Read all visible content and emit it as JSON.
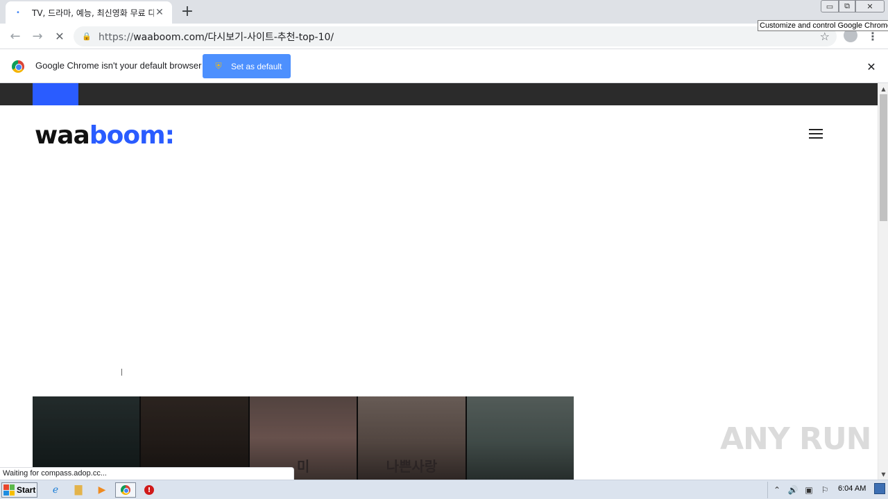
{
  "browser": {
    "tab": {
      "title": "TV, 드라마, 예능, 최신영화 무료 다시",
      "favicon": "loading-dot-icon",
      "close_glyph": "✕"
    },
    "new_tab_glyph": "+",
    "window_controls": {
      "minimize": "▭",
      "maximize": "⧉",
      "close": "✕"
    },
    "toolbar": {
      "back_glyph": "←",
      "forward_glyph": "→",
      "stop_glyph": "✕",
      "url_scheme": "https://",
      "url_rest": "waaboom.com/다시보기-사이트-추천-top-10/",
      "star_glyph": "☆",
      "menu_glyph": "⋮"
    },
    "tooltip": "Customize and control Google Chrome",
    "infobar": {
      "message": "Google Chrome isn't your default browser",
      "button_label": "Set as default",
      "close_glyph": "✕"
    },
    "status_text": "Waiting for compass.adop.cc..."
  },
  "page": {
    "logo_part1": "waa",
    "logo_part2": "boom:",
    "accent_color": "#2a5cff",
    "banner_posters": [
      {
        "name": "poster-1",
        "text": ""
      },
      {
        "name": "poster-2",
        "text": ""
      },
      {
        "name": "poster-3",
        "text": "미"
      },
      {
        "name": "poster-4",
        "text": "나쁜사랑"
      },
      {
        "name": "poster-5",
        "text": ""
      }
    ],
    "watermark": "ANY RUN"
  },
  "taskbar": {
    "start_label": "Start",
    "clock": "6:04 AM"
  }
}
